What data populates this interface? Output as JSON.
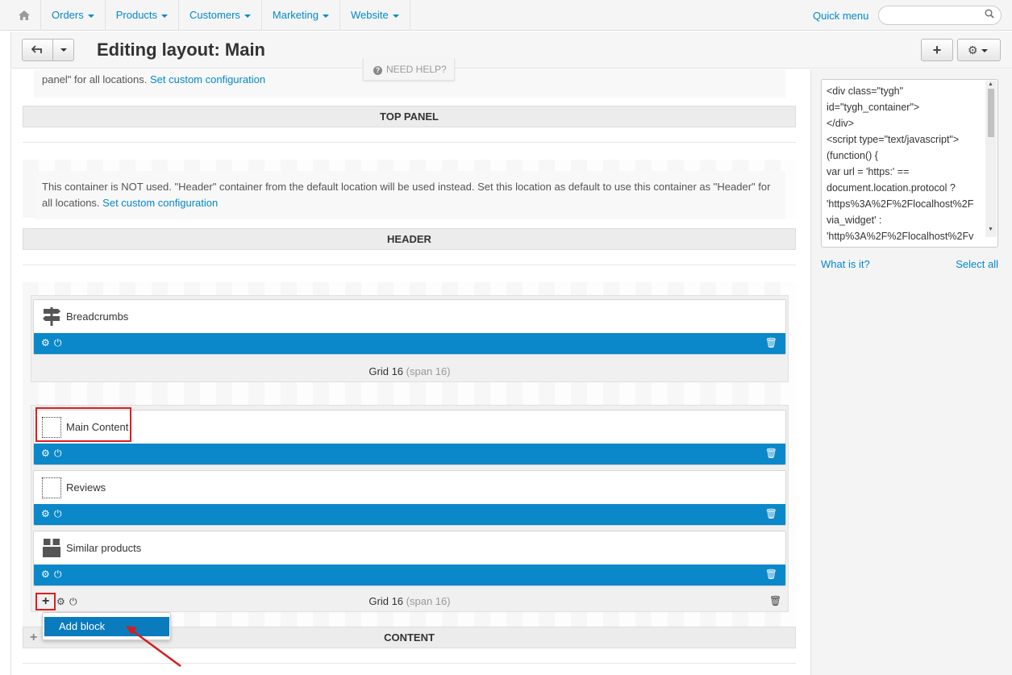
{
  "nav": {
    "home_icon": "home-icon",
    "items": [
      {
        "label": "Orders"
      },
      {
        "label": "Products"
      },
      {
        "label": "Customers"
      },
      {
        "label": "Marketing"
      },
      {
        "label": "Website"
      }
    ],
    "quick_menu": "Quick menu",
    "search_placeholder": ""
  },
  "header": {
    "title": "Editing layout: Main",
    "need_help": "NEED HELP?"
  },
  "sidebar": {
    "code": "<div class=\"tygh\"\nid=\"tygh_container\">\n</div>\n<script type=\"text/javascript\">\n(function() {\nvar url = 'https:' ==\ndocument.location.protocol ?\n'https%3A%2F%2Flocalhost%2F\nvia_widget' :\n'http%3A%2F%2Flocalhost%2Fv",
    "what_is_it": "What is it?",
    "select_all": "Select all"
  },
  "top_panel": {
    "notice_prefix": "panel\" for all locations.",
    "notice_link": "Set custom configuration",
    "label": "TOP PANEL"
  },
  "header_container": {
    "notice_text": "This container is NOT used. \"Header\" container from the default location will be used instead. Set this location as default to use this container as \"Header\" for all locations.",
    "notice_link": "Set custom configuration",
    "label": "HEADER"
  },
  "content": {
    "label": "CONTENT",
    "grids": [
      {
        "name": "Grid 16",
        "span": "(span 16)",
        "blocks": [
          {
            "name": "Breadcrumbs",
            "icon": "signpost-icon"
          }
        ]
      },
      {
        "name": "Grid 16",
        "span": "(span 16)",
        "blocks": [
          {
            "name": "Main Content",
            "icon": "dotted-box-icon"
          },
          {
            "name": "Reviews",
            "icon": "dotted-box-icon"
          },
          {
            "name": "Similar products",
            "icon": "box-icon"
          }
        ]
      }
    ],
    "add_menu": {
      "item": "Add block"
    }
  }
}
